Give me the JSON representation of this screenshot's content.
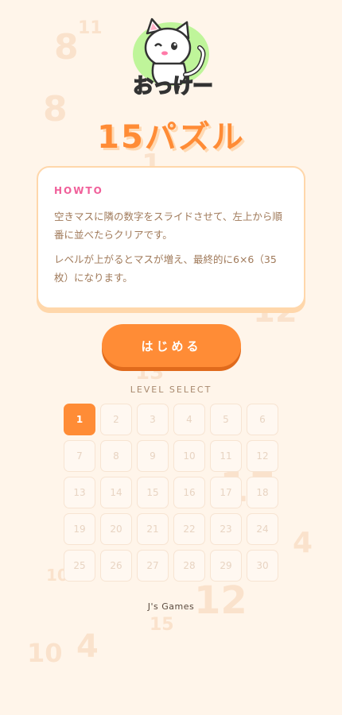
{
  "background_numbers": [
    "8",
    "11",
    "8",
    "1",
    "12",
    "13",
    "7",
    "15",
    "4",
    "10",
    "12",
    "15",
    "4",
    "10"
  ],
  "logo": {
    "text": "おっけー"
  },
  "title": "15パズル",
  "howto": {
    "heading": "HOWTO",
    "paragraph1": "空きマスに隣の数字をスライドさせて、左上から順番に並べたらクリアです。",
    "paragraph2": "レベルが上がるとマスが増え、最終的に6×6（35枚）になります。"
  },
  "start_button": "はじめる",
  "level_select": {
    "label": "LEVEL SELECT",
    "levels": [
      "1",
      "2",
      "3",
      "4",
      "5",
      "6",
      "7",
      "8",
      "9",
      "10",
      "11",
      "12",
      "13",
      "14",
      "15",
      "16",
      "17",
      "18",
      "19",
      "20",
      "21",
      "22",
      "23",
      "24",
      "25",
      "26",
      "27",
      "28",
      "29",
      "30"
    ],
    "selected": "1"
  },
  "footer": "J's Games",
  "colors": {
    "background": "#fff5ea",
    "accent": "#ff8c36",
    "howto_heading": "#f0609a"
  }
}
